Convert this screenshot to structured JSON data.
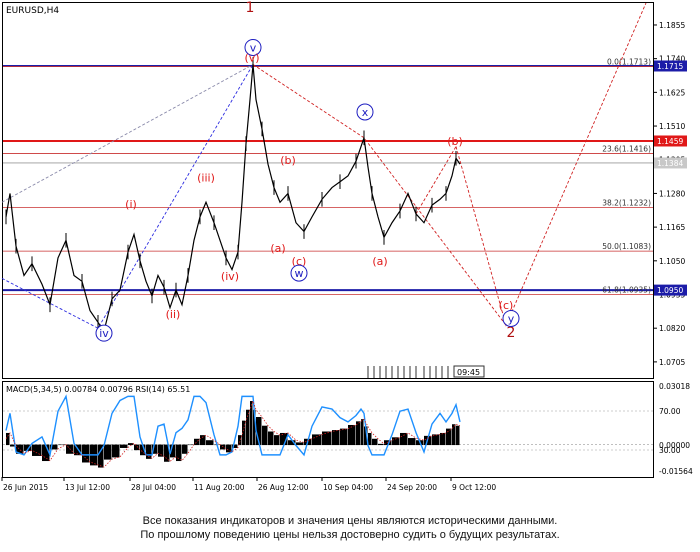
{
  "chart_data": [
    {
      "type": "line",
      "title": "EURUSD,H4",
      "price_axis_ticks": [
        "1.1855",
        "1.1740",
        "1.1625",
        "1.1510",
        "1.1395",
        "1.1280",
        "1.1165",
        "1.1050",
        "1.0935",
        "1.0820",
        "1.0705"
      ],
      "ylim": [
        1.065,
        1.193
      ],
      "time_axis_labels": [
        "26 Jun 2015",
        "13 Jul 12:00",
        "28 Jul 04:00",
        "11 Aug 20:00",
        "26 Aug 12:00",
        "10 Sep 04:00",
        "24 Sep 20:00",
        "9 Oct 12:00"
      ],
      "price_series": [
        [
          0,
          1.12
        ],
        [
          4,
          1.128
        ],
        [
          10,
          1.11
        ],
        [
          18,
          1.1
        ],
        [
          26,
          1.104
        ],
        [
          36,
          1.097
        ],
        [
          44,
          1.09
        ],
        [
          52,
          1.106
        ],
        [
          60,
          1.112
        ],
        [
          68,
          1.1
        ],
        [
          76,
          1.098
        ],
        [
          84,
          1.088
        ],
        [
          92,
          1.084
        ],
        [
          98,
          1.081
        ],
        [
          106,
          1.092
        ],
        [
          114,
          1.095
        ],
        [
          122,
          1.108
        ],
        [
          128,
          1.114
        ],
        [
          134,
          1.105
        ],
        [
          140,
          1.098
        ],
        [
          146,
          1.093
        ],
        [
          152,
          1.1
        ],
        [
          158,
          1.096
        ],
        [
          164,
          1.089
        ],
        [
          170,
          1.095
        ],
        [
          176,
          1.09
        ],
        [
          182,
          1.1
        ],
        [
          188,
          1.112
        ],
        [
          194,
          1.12
        ],
        [
          200,
          1.125
        ],
        [
          208,
          1.118
        ],
        [
          214,
          1.112
        ],
        [
          220,
          1.106
        ],
        [
          226,
          1.102
        ],
        [
          232,
          1.108
        ],
        [
          236,
          1.125
        ],
        [
          240,
          1.145
        ],
        [
          244,
          1.16
        ],
        [
          247,
          1.172
        ],
        [
          250,
          1.16
        ],
        [
          256,
          1.15
        ],
        [
          262,
          1.138
        ],
        [
          268,
          1.13
        ],
        [
          274,
          1.125
        ],
        [
          282,
          1.128
        ],
        [
          290,
          1.118
        ],
        [
          298,
          1.115
        ],
        [
          306,
          1.12
        ],
        [
          316,
          1.126
        ],
        [
          326,
          1.13
        ],
        [
          334,
          1.132
        ],
        [
          342,
          1.134
        ],
        [
          350,
          1.139
        ],
        [
          355,
          1.144
        ],
        [
          358,
          1.147
        ],
        [
          362,
          1.137
        ],
        [
          366,
          1.128
        ],
        [
          372,
          1.12
        ],
        [
          378,
          1.113
        ],
        [
          386,
          1.118
        ],
        [
          394,
          1.122
        ],
        [
          402,
          1.128
        ],
        [
          410,
          1.121
        ],
        [
          418,
          1.118
        ],
        [
          426,
          1.124
        ],
        [
          434,
          1.126
        ],
        [
          440,
          1.128
        ],
        [
          446,
          1.134
        ],
        [
          450,
          1.14
        ],
        [
          454,
          1.138
        ]
      ],
      "horizontal_lines": [
        {
          "price": 1.1715,
          "color": "#1c1ca8",
          "label": "1.1715"
        },
        {
          "price": 1.1459,
          "color": "#e01818",
          "label": "1.1459"
        },
        {
          "price": 1.095,
          "color": "#1c1ca8",
          "label": "1.0950"
        }
      ],
      "bid_label": "1.1384",
      "fibonacci": [
        {
          "label": "0.0(1.1713)",
          "price": 1.1713
        },
        {
          "label": "23.6(1.1416)",
          "price": 1.1416
        },
        {
          "label": "38.2(1.1232)",
          "price": 1.1232
        },
        {
          "label": "50.0(1.1083)",
          "price": 1.1083
        },
        {
          "label": "61.8(1.0935)",
          "price": 1.0935
        }
      ],
      "wave_labels": [
        {
          "text": "1",
          "color": "#b01010"
        },
        {
          "text": "2",
          "color": "#b01010"
        },
        {
          "text": "v",
          "color": "#1c1cc0"
        },
        {
          "text": "(v)",
          "color": "#e01818"
        },
        {
          "text": "iv",
          "color": "#1c1cc0"
        },
        {
          "text": "(i)",
          "color": "#e01818"
        },
        {
          "text": "(ii)",
          "color": "#e01818"
        },
        {
          "text": "(iii)",
          "color": "#e01818"
        },
        {
          "text": "(iv)",
          "color": "#e01818"
        },
        {
          "text": "(a)",
          "color": "#e01818"
        },
        {
          "text": "(b)",
          "color": "#e01818"
        },
        {
          "text": "(c)",
          "color": "#e01818"
        },
        {
          "text": "w",
          "color": "#1c1cc0"
        },
        {
          "text": "x",
          "color": "#1c1cc0"
        },
        {
          "text": "(a)",
          "color": "#e01818"
        },
        {
          "text": "(b)",
          "color": "#e01818"
        },
        {
          "text": "(c)",
          "color": "#e01818"
        },
        {
          "text": "y",
          "color": "#1c1cc0"
        }
      ],
      "time_marker": "09:45"
    },
    {
      "type": "area",
      "title": "MACD(5,34,5) 0.00784 0.00796 RSI(14) 65.51",
      "indicator_axis_ticks": [
        "0.03018",
        "70.00",
        "0.00000",
        "30.00",
        "-0.01564"
      ]
    }
  ],
  "footer": {
    "line1": "Все показания индикаторов и значения цены являются историческими данными.",
    "line2": "По прошлому поведению цены нельзя достоверно судить о будущих результатах."
  }
}
